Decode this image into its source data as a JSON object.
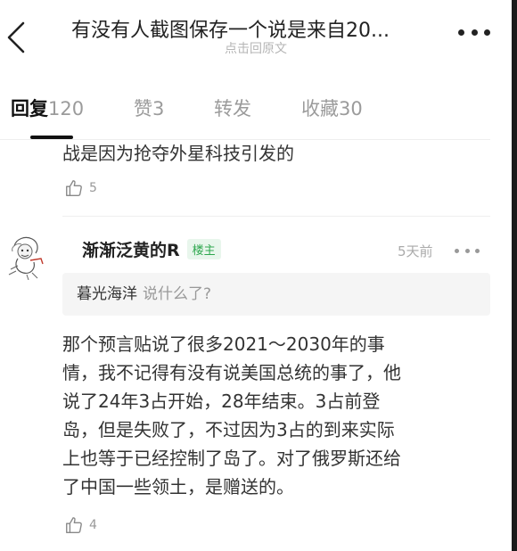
{
  "header": {
    "title": "有没有人截图保存一个说是来自20...",
    "subtitle": "点击回原文"
  },
  "tabs": [
    {
      "label": "回复",
      "count": "120"
    },
    {
      "label": "赞",
      "count": "3"
    },
    {
      "label": "转发",
      "count": ""
    },
    {
      "label": "收藏",
      "count": "30"
    }
  ],
  "previous_comment": {
    "text": "战是因为抢夺外星科技引发的",
    "likes": "5"
  },
  "comment": {
    "author": "渐渐泛黄的R",
    "badge": "楼主",
    "time": "5天前",
    "quote_user": "暮光海洋",
    "quote_text": "说什么了?",
    "lines": [
      "那个预言贴说了很多2021～2030年的事",
      "情，我不记得有没有说美国总统的事了，他",
      "说了24年3占开始，28年结束。3占前登",
      "岛，但是失败了，不过因为3占的到来实际",
      "上也等于已经控制了岛了。对了俄罗斯还给",
      "了中国一些领土，是赠送的。"
    ],
    "likes": "4"
  },
  "icons": {
    "back": "chevron-left-icon",
    "more": "more-dots-icon",
    "like": "thumbs-up-icon",
    "avatar": "avatar-doodle"
  },
  "colors": {
    "owner_badge_text": "#2fa84f",
    "owner_badge_bg": "#e8f6ec",
    "quote_bg": "#f5f5f5"
  }
}
